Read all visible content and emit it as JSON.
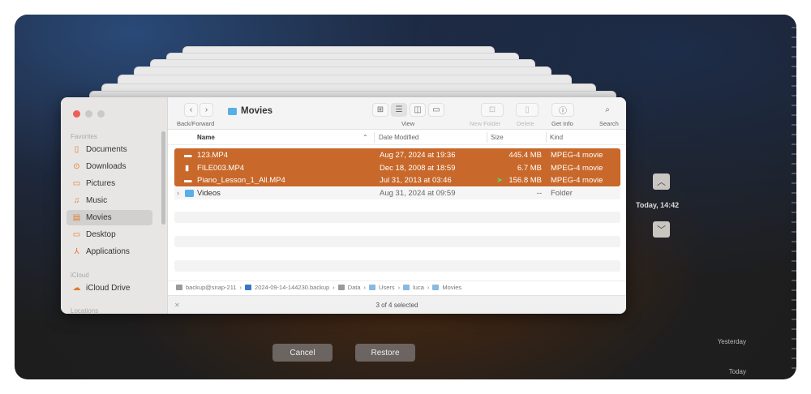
{
  "finder": {
    "title": "Movies",
    "toolbar": {
      "back_forward": "Back/Forward",
      "view": "View",
      "new_folder": "New Folder",
      "delete": "Delete",
      "get_info": "Get Info",
      "search": "Search"
    },
    "sidebar": {
      "favorites_label": "Favorites",
      "items": [
        {
          "label": "Documents",
          "icon": "document-icon"
        },
        {
          "label": "Downloads",
          "icon": "download-icon"
        },
        {
          "label": "Pictures",
          "icon": "pictures-icon"
        },
        {
          "label": "Music",
          "icon": "music-icon"
        },
        {
          "label": "Movies",
          "icon": "film-icon",
          "selected": true
        },
        {
          "label": "Desktop",
          "icon": "desktop-icon"
        },
        {
          "label": "Applications",
          "icon": "applications-icon"
        }
      ],
      "icloud_label": "iCloud",
      "icloud_drive": "iCloud Drive",
      "locations_label": "Locations"
    },
    "columns": {
      "name": "Name",
      "date": "Date Modified",
      "size": "Size",
      "kind": "Kind"
    },
    "files": [
      {
        "name": "123.MP4",
        "date": "Aug 27, 2024 at 19:36",
        "size": "445.4 MB",
        "kind": "MPEG-4 movie",
        "selected": true
      },
      {
        "name": "FILE003.MP4",
        "date": "Dec 18, 2008 at 18:59",
        "size": "6.7 MB",
        "kind": "MPEG-4 movie",
        "selected": true
      },
      {
        "name": "Piano_Lesson_1_All.MP4",
        "date": "Jul 31, 2013 at 03:46",
        "size": "156.8 MB",
        "kind": "MPEG-4 movie",
        "selected": true
      },
      {
        "name": "Videos",
        "date": "Aug 31, 2024 at 09:59",
        "size": "--",
        "kind": "Folder",
        "selected": false
      }
    ],
    "path": [
      "backup@snap-211",
      "2024-09-14-144230.backup",
      "Data",
      "Users",
      "luca",
      "Movies"
    ],
    "status": "3 of 4 selected",
    "selection_color": "#c8682a"
  },
  "buttons": {
    "cancel": "Cancel",
    "restore": "Restore"
  },
  "timeline": {
    "current": "Today, 14:42",
    "yesterday": "Yesterday",
    "today": "Today"
  }
}
